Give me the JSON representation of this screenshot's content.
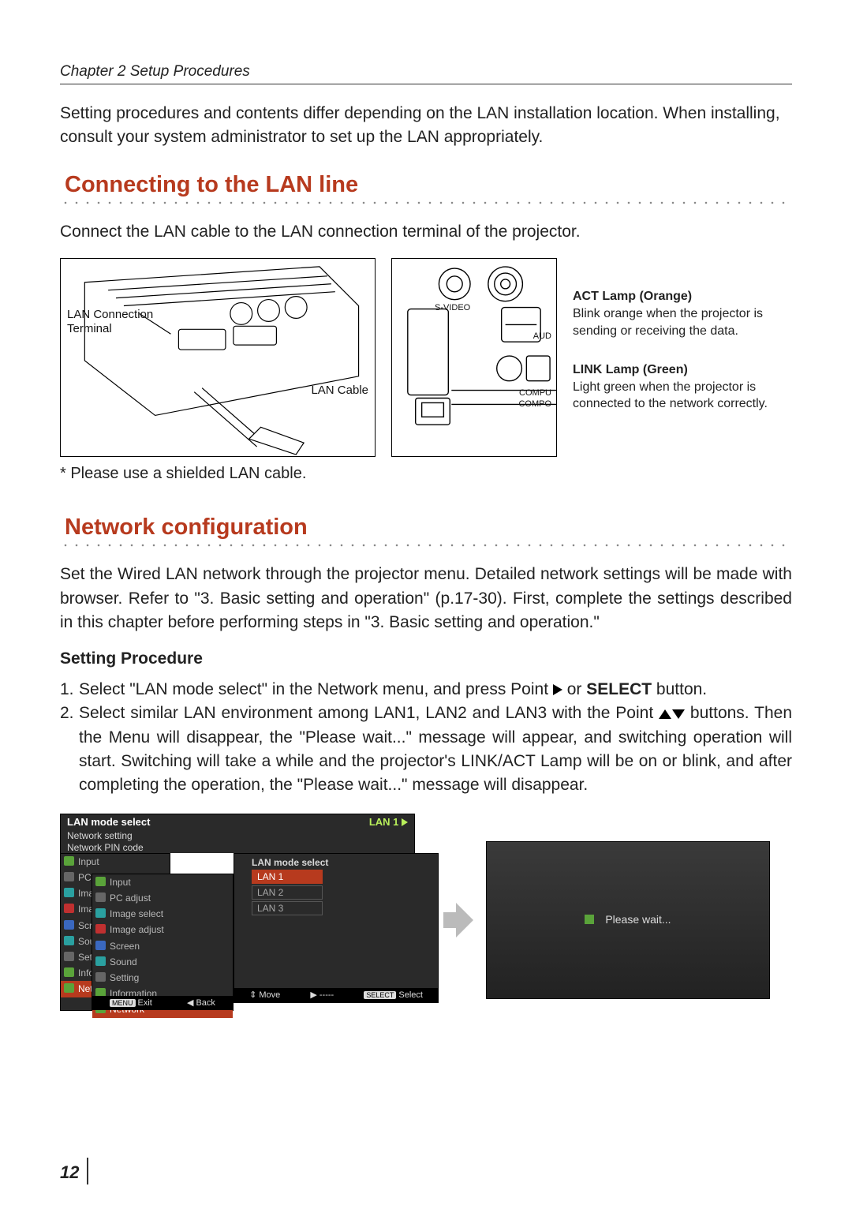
{
  "chapter": "Chapter 2 Setup Procedures",
  "intro": "Setting procedures and contents differ depending on the LAN installation location. When installing, consult your system administrator to set up the LAN appropriately.",
  "section1": {
    "title": "Connecting to the LAN line",
    "desc": "Connect the LAN cable to the LAN connection terminal of the projector.",
    "fig1": {
      "label_terminal": "LAN Connection Terminal",
      "label_cable": "LAN Cable"
    },
    "fig2": {
      "svideo": "S-VIDEO",
      "aud": "AUD",
      "comp1": "COMPU",
      "comp2": "COMPO"
    },
    "lamps": {
      "act_title": "ACT Lamp (Orange)",
      "act_desc": "Blink orange when the projector is sending or receiving the data.",
      "link_title": "LINK Lamp (Green)",
      "link_desc": "Light green when the projector is connected to the network correctly."
    },
    "footnote": "* Please use a shielded LAN cable."
  },
  "section2": {
    "title": "Network configuration",
    "desc": "Set the Wired LAN network through the projector menu. Detailed network settings will be made with browser. Refer to \"3. Basic setting and operation\" (p.17-30). First, complete the settings described in this chapter before performing steps in \"3. Basic setting and operation.\"",
    "subhead": "Setting Procedure",
    "step1_pre": "Select \"LAN mode select\" in the Network menu, and press Point ",
    "step1_mid": " or ",
    "step1_select": "SELECT",
    "step1_post": " button.",
    "step2_pre": "Select similar LAN environment among LAN1, LAN2 and LAN3 with the Point ",
    "step2_post": " buttons. Then the Menu will disappear, the \"Please wait...\" message will appear, and switching operation will start. Switching will take a while and the projector's LINK/ACT Lamp will be on or blink, and after completing the operation, the \"Please wait...\" message will disappear."
  },
  "menus": {
    "top_bar": {
      "left": "LAN mode select",
      "right": "LAN 1"
    },
    "top_sub1": "Network setting",
    "top_sub2": "Network PIN code",
    "panel_a": [
      "Input",
      "PC adjust",
      "Image select",
      "Image adjust",
      "Screen",
      "Sound",
      "Setting",
      "Information",
      "Network"
    ],
    "panel_b": [
      "Input",
      "PC adjust",
      "Image select",
      "Image adjust",
      "Screen",
      "Sound",
      "Setting",
      "Information",
      "Network"
    ],
    "panel_c_title": "LAN mode select",
    "panel_c_opts": [
      "LAN 1",
      "LAN 2",
      "LAN 3"
    ],
    "bottom_bar": {
      "exit_chip": "MENU",
      "exit": "Exit",
      "back": "Back",
      "move": "Move",
      "dash": "-----",
      "select_chip": "SELECT",
      "select": "Select"
    }
  },
  "wait_text": "Please wait...",
  "page_number": "12"
}
